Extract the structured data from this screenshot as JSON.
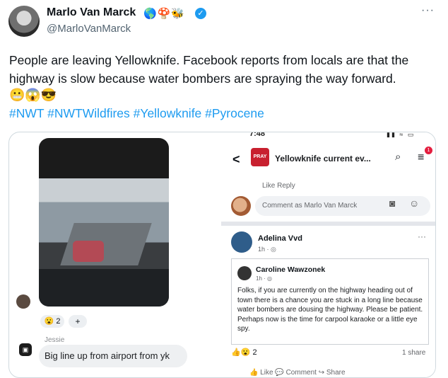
{
  "tweet": {
    "author_name": "Marlo Van Marck",
    "author_badges": "🌎🍄🐝",
    "handle": "@MarloVanMarck",
    "more_label": "···",
    "text": "People are leaving Yellowknife. Facebook reports from locals are that the highway is slow because water bombers are spraying the way forward.",
    "emojis": "😬😱😎",
    "hashtags": "#NWT #NWTWildfires #Yellowknife #Pyrocene"
  },
  "left_panel": {
    "reaction_count": "😮 2",
    "add_reaction": "+",
    "commenter": "Jessie",
    "comment": "Big line up from airport from yk",
    "comment_avatar_glyph": "▣"
  },
  "fb_panel": {
    "status_time": "7:48",
    "status_icons": "▮▮ ≈ ▭",
    "back": "<",
    "group_logo": "PRAY",
    "group_title": "Yellowknife current ev...",
    "search_icon": "⌕",
    "menu_icon": "≡",
    "notif_count": "1",
    "like_reply": "Like    Reply",
    "comment_placeholder": "Comment as Marlo Van Marck",
    "post_author": "Adelina Vvd",
    "post_time": "1h · ◎",
    "post_more": "···",
    "shared_author": "Caroline Wawzonek",
    "shared_time": "1h · ◎",
    "shared_text": "Folks, if you are currently on the highway heading out of town there is a chance you are stuck in a long line because water bombers are dousing the highway. Please be patient. Perhaps now is the time for carpool karaoke or a little eye spy.",
    "reactions": "👍😮 2",
    "share_count": "1 share",
    "bottom_actions": "👍 Like        💬 Comment        ↪ Share"
  },
  "colors": {
    "link": "#1d9bf0",
    "verified": "#1d9bf0",
    "fb_red": "#c8202f"
  }
}
